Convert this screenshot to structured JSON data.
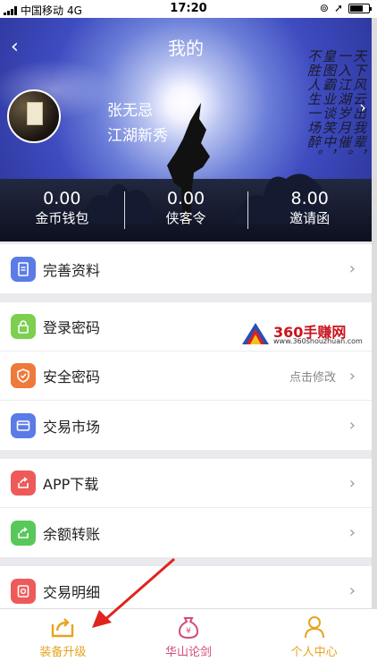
{
  "status": {
    "carrier": "中国移动",
    "network": "4G",
    "time": "17:20"
  },
  "header": {
    "back_icon": "back-chevron-icon",
    "title": "我的",
    "next_icon": "chevron-right-icon"
  },
  "profile": {
    "name": "张无忌",
    "level": "江湖新秀"
  },
  "poem_text": "天下风云出我辈，一入江湖岁月催。皇图霸业谈笑中，不胜人生一场醉。",
  "stats": [
    {
      "value": "0.00",
      "label": "金币钱包"
    },
    {
      "value": "0.00",
      "label": "侠客令"
    },
    {
      "value": "8.00",
      "label": "邀请函"
    }
  ],
  "menu": {
    "group1": [
      {
        "label": "完善资料",
        "icon": "document-icon",
        "color": "#5b7be6"
      }
    ],
    "group2": [
      {
        "label": "登录密码",
        "icon": "lock-icon",
        "color": "#7ccf4f"
      },
      {
        "label": "安全密码",
        "icon": "shield-icon",
        "color": "#ee7a3b",
        "sub": "点击修改"
      },
      {
        "label": "交易市场",
        "icon": "card-icon",
        "color": "#5b7be6"
      }
    ],
    "group3": [
      {
        "label": "APP下载",
        "icon": "share-icon",
        "color": "#ee5a5a"
      },
      {
        "label": "余额转账",
        "icon": "share-icon",
        "color": "#59c85a"
      }
    ],
    "group4": [
      {
        "label": "交易明细",
        "icon": "detail-icon",
        "color": "#ee5a5a"
      }
    ]
  },
  "watermark": {
    "brand": "360手赚网",
    "url": "www.360shouzhuan.com"
  },
  "tabs": [
    {
      "label": "装备升级",
      "icon": "upgrade-icon",
      "color": "#e6a41f"
    },
    {
      "label": "华山论剑",
      "icon": "moneybag-icon",
      "color": "#d24a7a"
    },
    {
      "label": "个人中心",
      "icon": "person-icon",
      "color": "#e6a41f"
    }
  ]
}
